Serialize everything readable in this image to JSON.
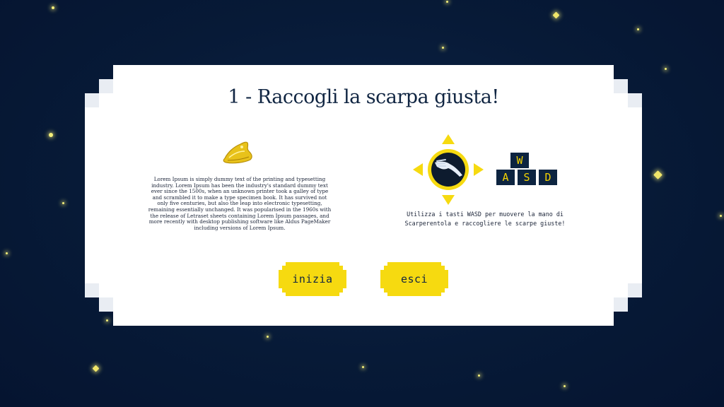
{
  "modal": {
    "title": "1 - Raccogli la scarpa giusta!",
    "description": "Lorem Ipsum is simply dummy text of the printing and typesetting industry. Lorem Ipsum has been the industry's standard dummy text ever since the 1500s, when an unknown printer took a galley of type and scrambled it to make a type specimen book. It has survived not only five centuries, but also the leap into electronic typesetting, remaining essentially unchanged. It was popularised in the 1960s with the release of Letraset sheets containing Lorem Ipsum passages, and more recently with desktop publishing software like Aldus PageMaker including versions of Lorem Ipsum.",
    "shoe_icon": "golden-shoe-icon",
    "controls": {
      "icon": "hand-joystick-icon",
      "keys": {
        "w": "W",
        "a": "A",
        "s": "S",
        "d": "D"
      },
      "instructions_line1": "Utilizza i tasti WASD per muovere la mano di",
      "instructions_line2": "Scarperentola e raccogliere le scarpe giuste!"
    },
    "buttons": {
      "start": "inizia",
      "exit": "esci"
    }
  },
  "colors": {
    "background": "#071a37",
    "panel": "#ffffff",
    "accent_yellow": "#f6da10",
    "navy_text": "#102542",
    "star": "#f4ef7a"
  }
}
